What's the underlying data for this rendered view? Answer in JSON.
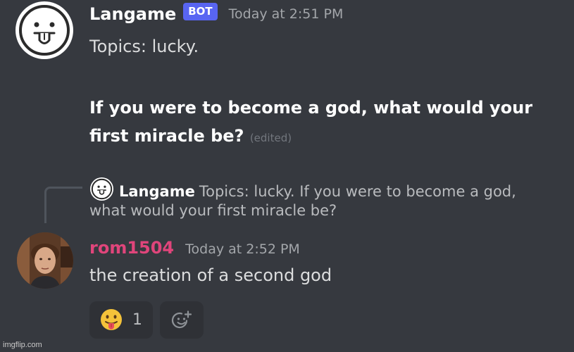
{
  "message1": {
    "username": "Langame",
    "badge": "BOT",
    "timestamp": "Today at 2:51 PM",
    "topics": "Topics: lucky.",
    "question": "If you were to become a god, what would your first miracle be?",
    "edited": "(edited)"
  },
  "reply_reference": {
    "username": "Langame",
    "preview_line1": "Topics: lucky.  If you were to become a god,",
    "preview_line2": "what would your first miracle be?"
  },
  "message2": {
    "username": "rom1504",
    "timestamp": "Today at 2:52 PM",
    "content": "the creation of a second god"
  },
  "reactions": [
    {
      "emoji": "stuck-out-tongue-emoji",
      "count": "1"
    }
  ],
  "add_reaction_icon": "add-reaction-icon",
  "watermark": "imgflip.com",
  "colors": {
    "background": "#36393f",
    "bot_badge": "#5865f2",
    "username2": "#e0457b",
    "reaction_bg": "#2f3136"
  }
}
